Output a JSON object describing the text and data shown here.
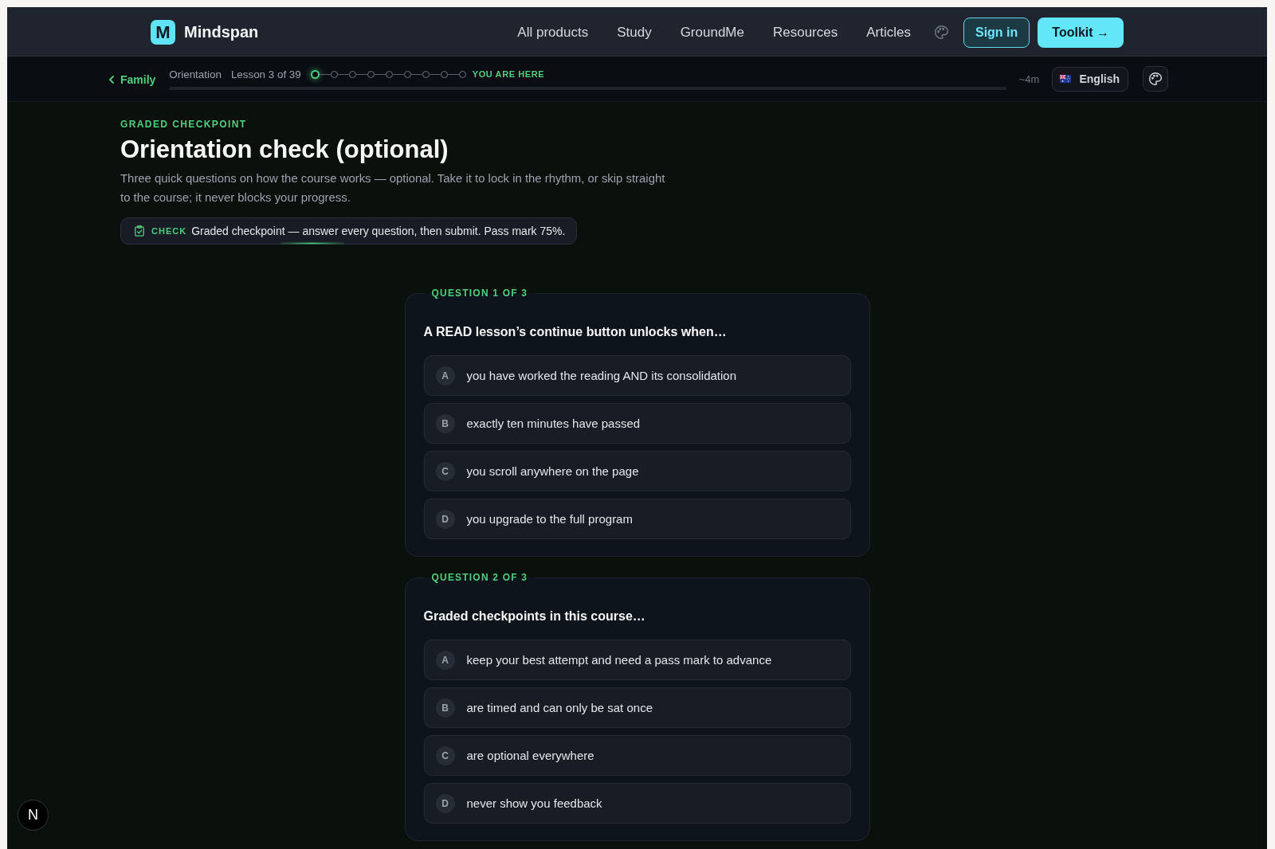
{
  "nav": {
    "logo_mark": "M",
    "brand": "Mindspan",
    "links": [
      "All products",
      "Study",
      "GroundMe",
      "Resources",
      "Articles"
    ],
    "sign_in": "Sign in",
    "cta": "Toolkit →"
  },
  "lesson_bar": {
    "back": "Family",
    "section": "Orientation",
    "lesson": "Lesson 3 of 39",
    "steps": [
      {
        "current": true
      },
      {
        "current": false
      },
      {
        "current": false
      },
      {
        "current": false
      },
      {
        "current": false
      },
      {
        "current": false
      },
      {
        "current": false
      },
      {
        "current": false
      },
      {
        "current": false
      }
    ],
    "here_label": "YOU ARE HERE",
    "duration": "~4m",
    "language": "English"
  },
  "checkpoint": {
    "eyebrow": "GRADED CHECKPOINT",
    "title": "Orientation check (optional)",
    "description": "Three quick questions on how the course works — optional. Take it to lock in the rhythm, or skip straight to the course; it never blocks your progress.",
    "notice": {
      "tag": "CHECK",
      "text": "Graded checkpoint — answer every question, then submit. Pass mark 75%."
    }
  },
  "questions": [
    {
      "label": "QUESTION 1 OF 3",
      "prompt": "A READ lesson’s continue button unlocks when…",
      "options": [
        {
          "letter": "A",
          "text": "you have worked the reading AND its consolidation",
          "selected": false
        },
        {
          "letter": "B",
          "text": "exactly ten minutes have passed",
          "selected": false
        },
        {
          "letter": "C",
          "text": "you scroll anywhere on the page",
          "selected": false
        },
        {
          "letter": "D",
          "text": "you upgrade to the full program",
          "selected": false
        }
      ]
    },
    {
      "label": "QUESTION 2 OF 3",
      "prompt": "Graded checkpoints in this course…",
      "options": [
        {
          "letter": "A",
          "text": "keep your best attempt and need a pass mark to advance",
          "selected": false
        },
        {
          "letter": "B",
          "text": "are timed and can only be sat once",
          "selected": false
        },
        {
          "letter": "C",
          "text": "are optional everywhere",
          "selected": false
        },
        {
          "letter": "D",
          "text": "never show you feedback",
          "selected": false
        }
      ]
    }
  ],
  "dev_badge": "N"
}
